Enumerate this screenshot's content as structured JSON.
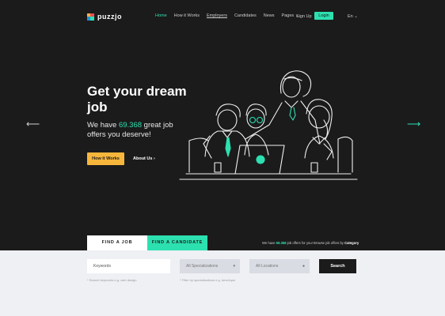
{
  "brand": {
    "name": "puzzjo"
  },
  "nav": {
    "items": [
      "Home",
      "How it Works",
      "Employers",
      "Candidates",
      "News",
      "Pages"
    ],
    "signup": "Sign Up",
    "login": "Login",
    "language": "En"
  },
  "hero": {
    "headline": "Get your dream job",
    "sub_prefix": "We have ",
    "sub_number": "69.368",
    "sub_suffix": " great job offers you deserve!",
    "how_button": "How it Works",
    "about_link": "About Us"
  },
  "tabs": {
    "find_job": "FIND A JOB",
    "find_candidate": "FIND A CANDIDATE"
  },
  "tagline": {
    "prefix": "We have ",
    "number": "69.368",
    "middle": " job offers for you! Browse job offers by ",
    "link": "Category"
  },
  "search": {
    "keywords_placeholder": "Keywords",
    "specializations": "All Specializations",
    "locations": "All Locations",
    "search_button": "Search",
    "hint_keywords": "* Search keywords e.g. web design",
    "hint_spec": "* Filter by specializations e.g. developer"
  },
  "colors": {
    "accent": "#2de0b0",
    "cta": "#f6b63c",
    "background": "#1b1b1b",
    "panel": "#eef0f4"
  }
}
